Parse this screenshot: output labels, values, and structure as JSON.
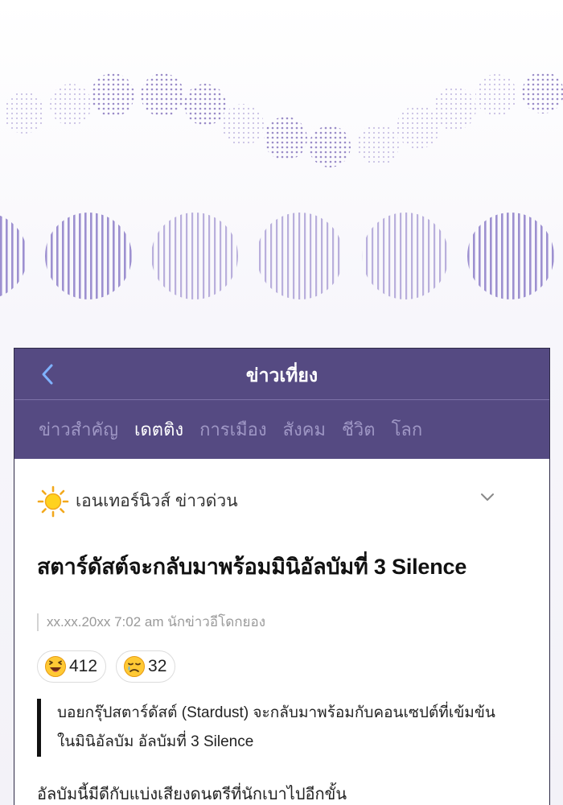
{
  "header": {
    "title": "ข่าวเที่ยง",
    "back_icon": "chevron-left-icon"
  },
  "tabs": [
    {
      "label": "ข่าวสำคัญ",
      "active": false
    },
    {
      "label": "เดตติง",
      "active": true
    },
    {
      "label": "การเมือง",
      "active": false
    },
    {
      "label": "สังคม",
      "active": false
    },
    {
      "label": "ชีวิต",
      "active": false
    },
    {
      "label": "โลก",
      "active": false
    }
  ],
  "category": {
    "icon": "sun-icon",
    "label": "เอนเทอร์นิวส์ ข่าวด่วน",
    "dropdown_icon": "chevron-down-icon"
  },
  "article": {
    "headline": "สตาร์ดัสต์จะกลับมาพร้อมมินิอัลบัมที่ 3 Silence",
    "meta": "xx.xx.20xx 7:02 am นักข่าวอีโดกยอง",
    "reactions": [
      {
        "icon": "laughing-face-icon",
        "count": "412"
      },
      {
        "icon": "crying-face-icon",
        "count": "32"
      }
    ],
    "quote_line1": "บอยกรุ๊ปสตาร์ดัสต์ (Stardust) จะกลับมาพร้อมกับคอนเซปต์ที่เข้มข้น",
    "quote_line2": "ในมินิอัลบัม อัลบัมที่ 3 Silence",
    "body": "อัลบัมนี้มีดีกับแบ่งเสียงดนตรีที่นักเบาไปอีกขั้น"
  },
  "colors": {
    "header_bg": "#554a82",
    "tab_inactive": "#9e96c4",
    "decor_purple": "#8f7fc4"
  }
}
